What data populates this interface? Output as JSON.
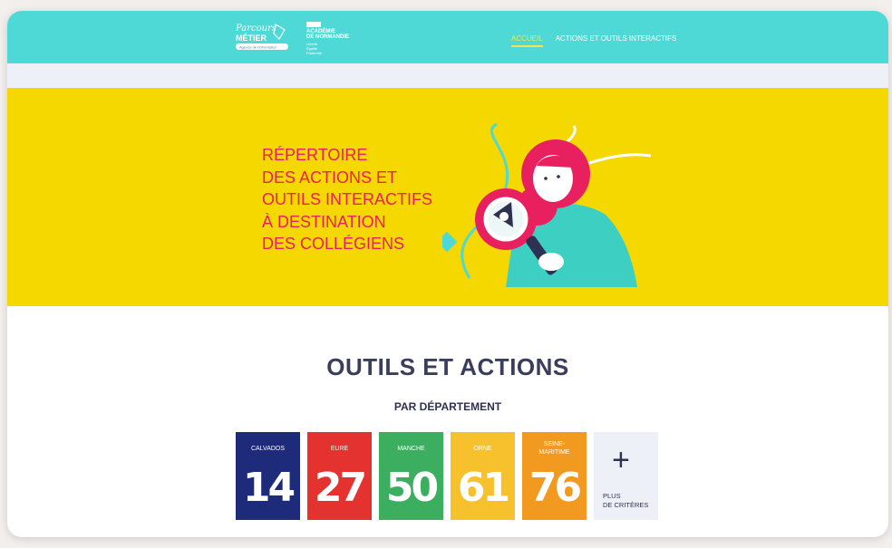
{
  "header": {
    "logo_line1": "Parcours",
    "logo_line2": "MÉTIER",
    "logo_tagline": "Agence de l'Orientation",
    "academie_line1": "ACADÉMIE",
    "academie_line2": "DE NORMANDIE",
    "academie_small": [
      "Liberté",
      "Égalité",
      "Fraternité"
    ],
    "nav": [
      {
        "label": "ACCUEIL",
        "active": true
      },
      {
        "label": "ACTIONS ET OUTILS INTERACTIFS",
        "active": false
      }
    ]
  },
  "hero": {
    "title_lines": [
      "RÉPERTOIRE",
      "DES ACTIONS ET",
      "OUTILS INTERACTIFS",
      "À DESTINATION",
      "DES COLLÉGIENS"
    ]
  },
  "section": {
    "title": "OUTILS ET ACTIONS",
    "subtitle": "PAR DÉPARTEMENT"
  },
  "departments": [
    {
      "name": "CALVADOS",
      "number": "14",
      "color": "#1e2a7a"
    },
    {
      "name": "EURE",
      "number": "27",
      "color": "#e4322e"
    },
    {
      "name": "MANCHE",
      "number": "50",
      "color": "#3cae60"
    },
    {
      "name": "ORNE",
      "number": "61",
      "color": "#f7c12d"
    },
    {
      "name": "SEINE-\nMARITIME",
      "number": "76",
      "color": "#f29a1f"
    }
  ],
  "more": {
    "symbol": "+",
    "label_line1": "PLUS",
    "label_line2": "DE CRITÈRES"
  },
  "colors": {
    "header": "#4ed9d6",
    "hero": "#f5d800",
    "hero_text": "#e8205f",
    "nav_active": "#f9e24c"
  }
}
